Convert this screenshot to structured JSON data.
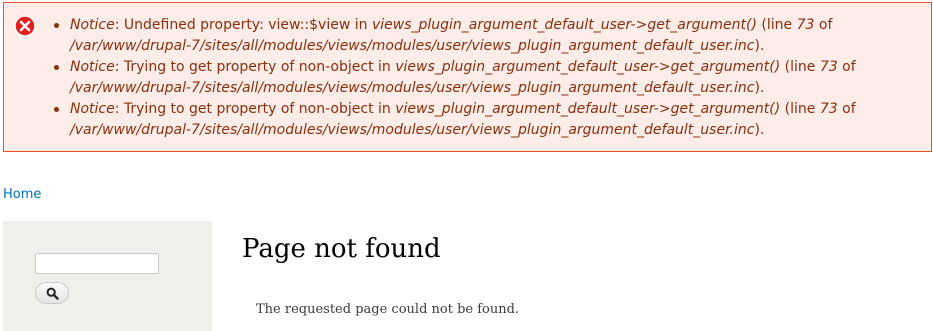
{
  "messages": {
    "icon": "error-icon",
    "border_color": "#ed541d",
    "background_color": "#fcede9",
    "text_color": "#8c2e0b",
    "items": [
      {
        "level": "Notice",
        "text_before": ": Undefined property: view::$view in ",
        "function": "views_plugin_argument_default_user->get_argument()",
        "line_prefix": " (line ",
        "line": "73",
        "of_text": " of ",
        "path": "/var/www/drupal-7/sites/all/modules/views/modules/user/views_plugin_argument_default_user.inc",
        "suffix": ")."
      },
      {
        "level": "Notice",
        "text_before": ": Trying to get property of non-object in ",
        "function": "views_plugin_argument_default_user->get_argument()",
        "line_prefix": " (line ",
        "line": "73",
        "of_text": " of ",
        "path": "/var/www/drupal-7/sites/all/modules/views/modules/user/views_plugin_argument_default_user.inc",
        "suffix": ")."
      },
      {
        "level": "Notice",
        "text_before": ": Trying to get property of non-object in ",
        "function": "views_plugin_argument_default_user->get_argument()",
        "line_prefix": " (line ",
        "line": "73",
        "of_text": " of ",
        "path": "/var/www/drupal-7/sites/all/modules/views/modules/user/views_plugin_argument_default_user.inc",
        "suffix": ")."
      }
    ]
  },
  "breadcrumb": {
    "home_label": "Home",
    "link_color": "#0071b3"
  },
  "sidebar": {
    "search": {
      "input_value": "",
      "button_icon": "search-icon"
    }
  },
  "main": {
    "title": "Page not found",
    "body": "The requested page could not be found."
  }
}
